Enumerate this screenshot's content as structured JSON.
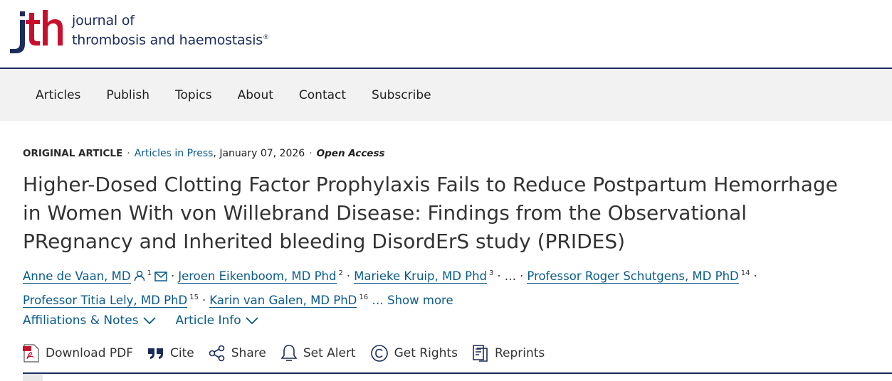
{
  "journal": {
    "line1": "journal of",
    "line2": "thrombosis and haemostasis",
    "mark": "®"
  },
  "nav": [
    "Articles",
    "Publish",
    "Topics",
    "About",
    "Contact",
    "Subscribe"
  ],
  "meta": {
    "type": "ORIGINAL ARTICLE",
    "section": "Articles in Press",
    "date": ", January 07, 2026",
    "access": "Open Access"
  },
  "title": "Higher-Dosed Clotting Factor Prophylaxis Fails to Reduce Postpartum Hemorrhage in Women With von Willebrand Disease: Findings from the Observational PRegnancy and Inherited bleeding DisordErS study (PRIDES)",
  "authors": [
    {
      "name": "Anne de Vaan, MD",
      "sup": "1"
    },
    {
      "name": "Jeroen Eikenboom, MD Phd",
      "sup": "2"
    },
    {
      "name": "Marieke Kruip, MD Phd",
      "sup": "3"
    },
    {
      "name": "Professor Roger Schutgens, MD PhD",
      "sup": "14"
    },
    {
      "name": "Professor Titia Lely, MD PhD",
      "sup": "15"
    },
    {
      "name": "Karin van Galen, MD PhD",
      "sup": "16"
    }
  ],
  "authors_ellipsis": "…",
  "show_more": "… Show more",
  "infos": {
    "affiliations": "Affiliations & Notes",
    "article_info": "Article Info"
  },
  "tools": {
    "download": "Download PDF",
    "cite": "Cite",
    "share": "Share",
    "alert": "Set Alert",
    "rights": "Get Rights",
    "reprints": "Reprints"
  },
  "colors": {
    "brand": "#1a2b5c",
    "link": "#0a5a8a",
    "logo_red": "#c8102e",
    "nav_bg": "#f2f2f2"
  }
}
